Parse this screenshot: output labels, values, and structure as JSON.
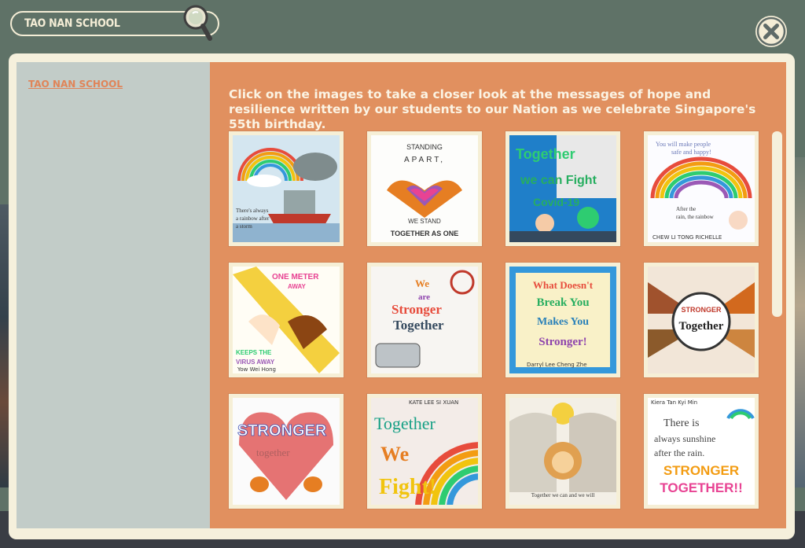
{
  "search": {
    "value": "TAO NAN SCHOOL"
  },
  "sidebar": {
    "schools": [
      {
        "label": "TAO NAN SCHOOL"
      }
    ]
  },
  "main": {
    "intro": "Click on the images to take a closer look at the messages of hope and resilience written by our students to our Nation as we celebrate Singapore's 55th birthday."
  },
  "artworks": [
    {
      "text": "There's always a rainbow after a storm",
      "caption": ""
    },
    {
      "text": "STANDING APART, WE STAND TOGETHER AS ONE",
      "caption": ""
    },
    {
      "text": "Together we can Fight Covid-19",
      "caption": ""
    },
    {
      "text": "You will make people safe and happy! After the rain, the rainbow will come!",
      "caption": "CHEW LI TONG RICHELLE"
    },
    {
      "text": "ONE METER AWAY KEEPS THE VIRUS AWAY",
      "caption": "Yow Wei Hong"
    },
    {
      "text": "We are Stronger Together",
      "caption": ""
    },
    {
      "text": "What Doesn't Break You Makes You Stronger!",
      "caption": "Darryl Lee Cheng Zhe"
    },
    {
      "text": "STRONGER Together",
      "caption": ""
    },
    {
      "text": "STRONGER together",
      "caption": ""
    },
    {
      "text": "Together We Fight!",
      "caption": "KATE LEE SI XUAN"
    },
    {
      "text": "STRONGER TOGETHER Together we can and we will",
      "caption": ""
    },
    {
      "text": "There is always sunshine after the rain. STRONGER TOGETHER!!",
      "caption": "Kiera Tan Kyi Min"
    }
  ],
  "colors": {
    "background": "#5f7267",
    "modal_frame": "#f5f0dc",
    "sidebar": "#c2ccc8",
    "content": "#e1905f",
    "link": "#e08458",
    "text_light": "#fbf3e3"
  }
}
